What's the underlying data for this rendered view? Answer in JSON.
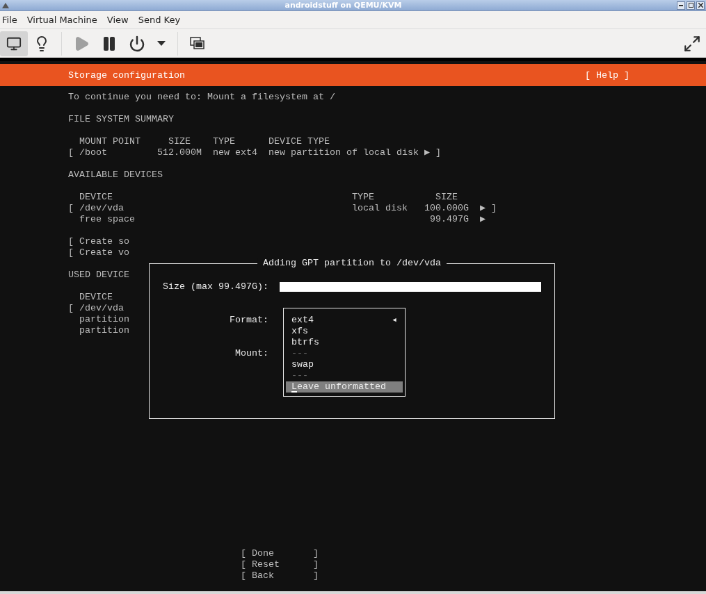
{
  "window": {
    "title": "androidstuff on QEMU/KVM"
  },
  "menu": [
    {
      "label": "File"
    },
    {
      "label": "Virtual Machine"
    },
    {
      "label": "View"
    },
    {
      "label": "Send Key"
    }
  ],
  "toolbar": [
    {
      "kind": "console",
      "selected": true,
      "disabled": false
    },
    {
      "kind": "details",
      "selected": false,
      "disabled": false
    },
    {
      "kind": "run",
      "selected": false,
      "disabled": true
    },
    {
      "kind": "pause",
      "selected": false,
      "disabled": false
    },
    {
      "kind": "power",
      "selected": false,
      "disabled": false
    },
    {
      "kind": "power_menu",
      "selected": false,
      "disabled": false
    },
    {
      "kind": "snapshots",
      "selected": false,
      "disabled": false
    },
    {
      "kind": "fullscreen",
      "selected": false,
      "disabled": false
    }
  ],
  "screen": {
    "header_title": "Storage configuration",
    "help": "[ Help ]",
    "message": "To continue you need to: Mount a filesystem at /",
    "fs_summary": {
      "heading": "FILE SYSTEM SUMMARY",
      "columns": [
        "MOUNT POINT",
        "SIZE",
        "TYPE",
        "DEVICE TYPE"
      ],
      "rows": [
        {
          "open": "[",
          "mount_point": "/boot",
          "size": "512.000M",
          "type": "new ext4",
          "device_type": "new partition of local disk",
          "arrow": "▶",
          "close": "]"
        }
      ]
    },
    "available_devices": {
      "heading": "AVAILABLE DEVICES",
      "columns": [
        "DEVICE",
        "TYPE",
        "SIZE"
      ],
      "rows": [
        {
          "open": "[",
          "device": "/dev/vda",
          "type": "local disk",
          "size": "100.000G",
          "arrow": "▶",
          "close": "]"
        },
        {
          "device": "free space",
          "size": "99.497G",
          "arrow": "▶"
        }
      ]
    },
    "actions": [
      {
        "open": "[",
        "label": "Create so"
      },
      {
        "open": "[",
        "label": "Create vo"
      }
    ],
    "used_devices": {
      "heading": "USED DEVICE",
      "columns": [
        "DEVICE"
      ],
      "rows": [
        {
          "open": "[",
          "device": "/dev/vda"
        },
        {
          "device": "partition"
        },
        {
          "device": "partition"
        }
      ]
    },
    "buttons": [
      {
        "open": "[",
        "label": "Done",
        "close": "]"
      },
      {
        "open": "[",
        "label": "Reset",
        "close": "]"
      },
      {
        "open": "[",
        "label": "Back",
        "close": "]"
      }
    ]
  },
  "dialog": {
    "title": "Adding GPT partition to /dev/vda",
    "size_label": "Size (max 99.497G):",
    "format_label": "Format:",
    "mount_label": "Mount:",
    "current_marker": "◂",
    "format_options": [
      {
        "kind": "option",
        "label": "ext4",
        "current": true,
        "selected": false
      },
      {
        "kind": "option",
        "label": "xfs",
        "current": false,
        "selected": false
      },
      {
        "kind": "option",
        "label": "btrfs",
        "current": false,
        "selected": false
      },
      {
        "kind": "separator",
        "label": "---"
      },
      {
        "kind": "option",
        "label": "swap",
        "current": false,
        "selected": false
      },
      {
        "kind": "separator",
        "label": "---"
      },
      {
        "kind": "option",
        "label": "Leave unformatted",
        "current": false,
        "selected": true
      }
    ]
  }
}
